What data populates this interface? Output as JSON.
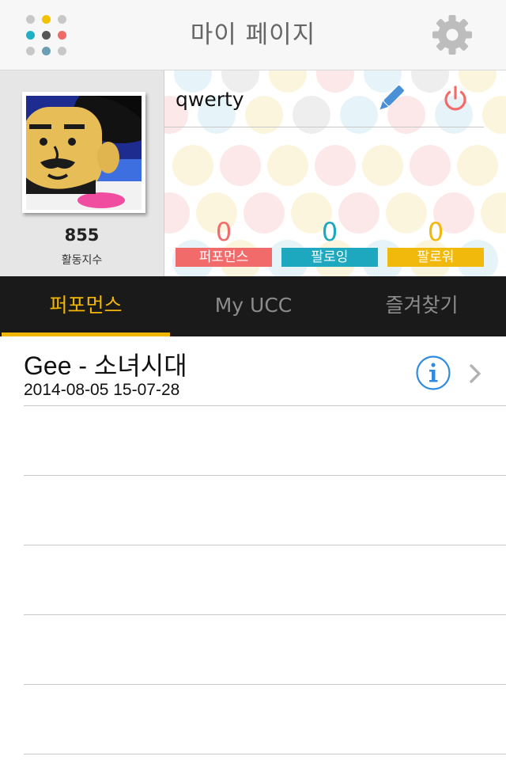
{
  "header": {
    "title": "마이 페이지",
    "menu_dot_colors": [
      "#c8c8c8",
      "#f2c200",
      "#c8c8c8",
      "#1fb0c8",
      "#555555",
      "#f06a6a",
      "#c8c8c8",
      "#6a9fb5",
      "#c8c8c8"
    ],
    "settings_icon": "gear-icon",
    "menu_icon": "grid-dots-icon"
  },
  "profile": {
    "username": "qwerty",
    "activity_score": "855",
    "activity_label": "활동지수",
    "edit_icon": "pencil-icon",
    "logout_icon": "power-icon",
    "stats": [
      {
        "value": "0",
        "label": "퍼포먼스",
        "color": "#f26b6b"
      },
      {
        "value": "0",
        "label": "팔로잉",
        "color": "#1ea8c0"
      },
      {
        "value": "0",
        "label": "팔로워",
        "color": "#f0b90b"
      }
    ]
  },
  "tabs": {
    "items": [
      "퍼포먼스",
      "My UCC",
      "즐겨찾기"
    ],
    "active_index": 0,
    "accent_color": "#f2b705"
  },
  "list": {
    "items": [
      {
        "title": "Gee - 소녀시대",
        "date": "2014-08-05 15-07-28",
        "info_icon": "info-icon",
        "chevron_icon": "chevron-right-icon"
      }
    ]
  }
}
